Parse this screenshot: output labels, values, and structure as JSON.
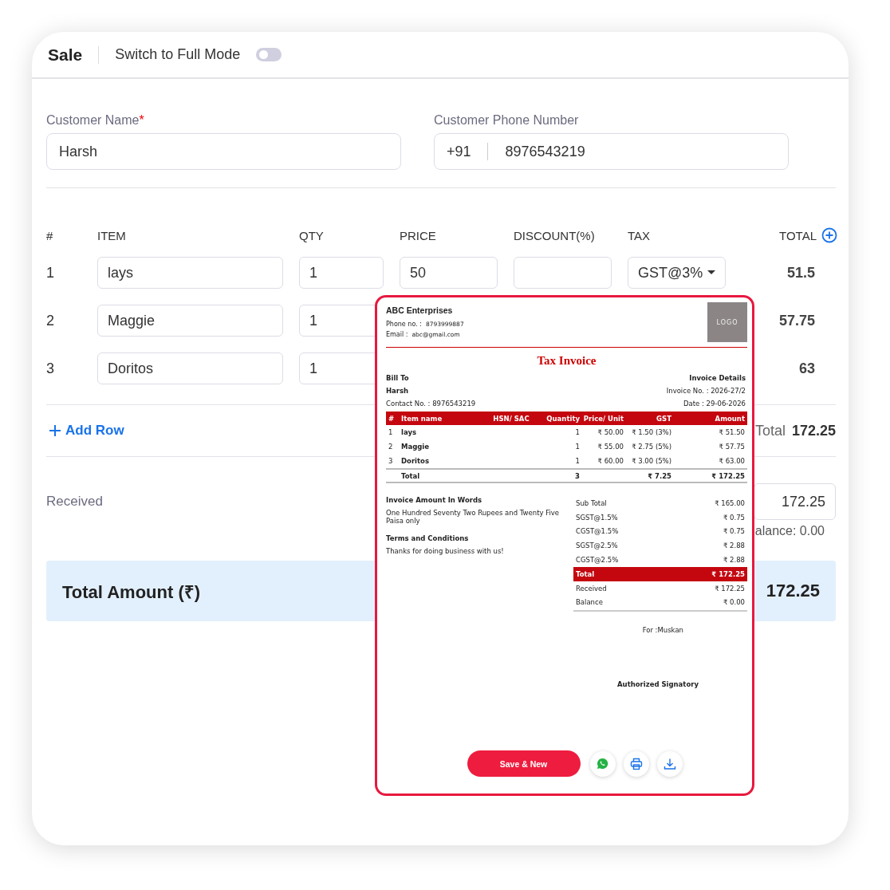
{
  "header": {
    "title": "Sale",
    "mode_label": "Switch to Full Mode",
    "full_mode": false
  },
  "customer": {
    "name_label": "Customer Name",
    "required_mark": "*",
    "name": "Harsh",
    "phone_label": "Customer Phone Number",
    "country_code": "+91",
    "phone": "8976543219"
  },
  "items": {
    "columns": [
      "#",
      "ITEM",
      "QTY",
      "PRICE",
      "DISCOUNT(%)",
      "TAX",
      "TOTAL"
    ],
    "rows": [
      {
        "index": "1",
        "item": "lays",
        "qty": "1",
        "price": "50",
        "tax": "GST@3%",
        "total": "51.5"
      },
      {
        "index": "2",
        "item": "Maggie",
        "qty": "1",
        "total": "57.75"
      },
      {
        "index": "3",
        "item": "Doritos",
        "qty": "1",
        "total": "63"
      }
    ]
  },
  "add_row": "Add Row",
  "summary": {
    "total_label": "Total",
    "total": "172.25",
    "received_label": "Received",
    "received": "172.25",
    "balance": "alance: 0.00",
    "amount_label": "Total Amount (₹)",
    "amount": "172.25"
  },
  "invoice": {
    "company": "ABC Enterprises",
    "phone_label": "Phone no. :",
    "phone": "8793999887",
    "email_label": "Email :",
    "email": "abc@gmail.com",
    "logo": "LOGO",
    "title": "Tax Invoice",
    "bill_to_label": "Bill To",
    "customer": "Harsh",
    "contact": "Contact No. : 8976543219",
    "details_label": "Invoice Details",
    "invoice_no": "Invoice No. : 2026-27/2",
    "date": "Date : 29-06-2026",
    "columns": [
      "#",
      "Item name",
      "HSN/ SAC",
      "Quantity",
      "Price/ Unit",
      "GST",
      "Amount"
    ],
    "rows": [
      [
        "1",
        "lays",
        "",
        "1",
        "₹ 50.00",
        "₹ 1.50 (3%)",
        "₹ 51.50"
      ],
      [
        "2",
        "Maggie",
        "",
        "1",
        "₹ 55.00",
        "₹ 2.75 (5%)",
        "₹ 57.75"
      ],
      [
        "3",
        "Doritos",
        "",
        "1",
        "₹ 60.00",
        "₹ 3.00 (5%)",
        "₹ 63.00"
      ]
    ],
    "total_row": {
      "label": "Total",
      "quantity": "3",
      "gst": "₹ 7.25",
      "amount": "₹ 172.25"
    },
    "words_label": "Invoice Amount In Words",
    "words": "One Hundred Seventy Two Rupees and Twenty Five Paisa only",
    "terms_label": "Terms and Conditions",
    "terms": "Thanks for doing business with us!",
    "totals": [
      {
        "label": "Sub Total",
        "value": "₹ 165.00",
        "highlight": false
      },
      {
        "label": "SGST@1.5%",
        "value": "₹ 0.75",
        "highlight": false
      },
      {
        "label": "CGST@1.5%",
        "value": "₹ 0.75",
        "highlight": false
      },
      {
        "label": "SGST@2.5%",
        "value": "₹ 2.88",
        "highlight": false
      },
      {
        "label": "CGST@2.5%",
        "value": "₹ 2.88",
        "highlight": false
      },
      {
        "label": "Total",
        "value": "₹ 172.25",
        "highlight": true
      },
      {
        "label": "Received",
        "value": "₹ 172.25",
        "highlight": false
      },
      {
        "label": "Balance",
        "value": "₹ 0.00",
        "highlight": false
      }
    ],
    "for_label": "For :Muskan",
    "signatory": "Authorized Signatory",
    "save_button": "Save & New"
  }
}
